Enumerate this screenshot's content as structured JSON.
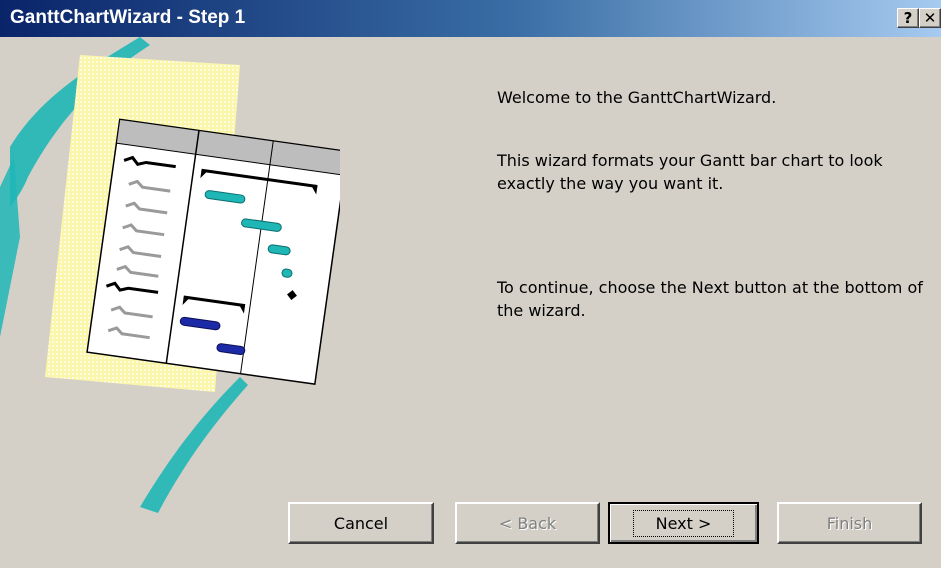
{
  "window": {
    "title": "GanttChartWizard - Step 1",
    "help_icon": "help-icon",
    "close_icon": "close-icon",
    "help_glyph": "?",
    "close_glyph": "✕"
  },
  "content": {
    "welcome": "Welcome to the GanttChartWizard.",
    "description": "This wizard formats your Gantt bar chart to look exactly the way you want it.",
    "instruction": "To continue, choose the Next button at the bottom of the wizard."
  },
  "buttons": {
    "cancel": "Cancel",
    "back": "< Back",
    "next": "Next >",
    "finish": "Finish"
  },
  "colors": {
    "titlebar_start": "#0a246a",
    "titlebar_end": "#a6caf0",
    "dialog_bg": "#d4d0c8",
    "teal_accent": "#1fb6b6",
    "navy_accent": "#1c2aa8",
    "paper_yellow": "#fcf7a8"
  }
}
